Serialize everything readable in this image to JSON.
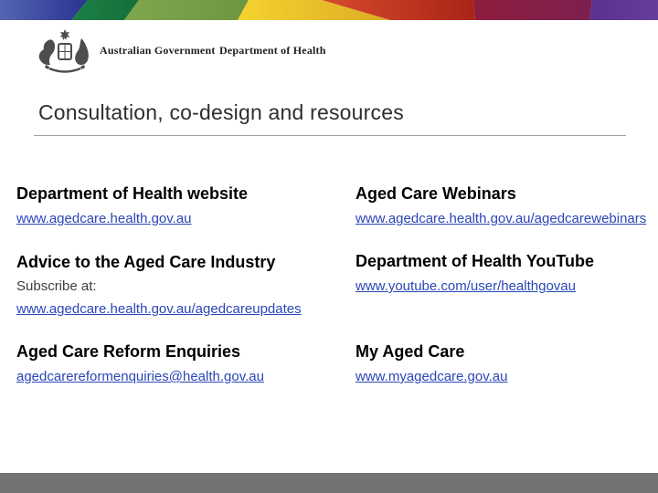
{
  "logo": {
    "icon": "australian-coat-of-arms",
    "line1": "Australian Government",
    "line2": "Department of Health"
  },
  "title": "Consultation, co-design and resources",
  "content": {
    "left": [
      {
        "heading": "Department of Health website",
        "link": "www.agedcare.health.gov.au"
      },
      {
        "heading": "Advice to the Aged Care Industry",
        "note": "Subscribe at:",
        "link": "www.agedcare.health.gov.au/agedcareupdates"
      },
      {
        "heading": "Aged Care Reform Enquiries",
        "link": "agedcarereformenquiries@health.gov.au"
      }
    ],
    "right": [
      {
        "heading": "Aged Care Webinars",
        "link": "www.agedcare.health.gov.au/agedcarewebinars"
      },
      {
        "heading": "Department of Health YouTube",
        "link": "www.youtube.com/user/healthgovau"
      },
      {
        "heading": "My Aged Care",
        "link": "www.myagedcare.gov.au"
      }
    ]
  },
  "colors": {
    "link": "#2a46b8",
    "footer_bar": "#737373",
    "title_rule": "#a0a0a0",
    "banner_segments": [
      "#4b5aa7",
      "#293390",
      "#1b8046",
      "#7aa14e",
      "#f5d32f",
      "#dcab26",
      "#d84b2b",
      "#a92517",
      "#8e1d3e",
      "#5d3494"
    ]
  }
}
